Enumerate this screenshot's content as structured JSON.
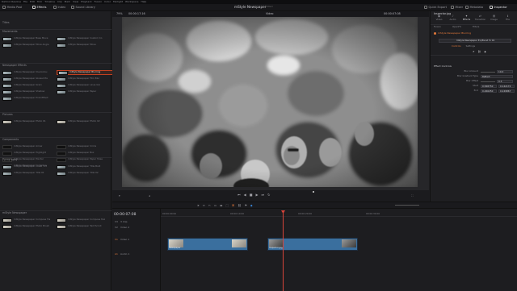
{
  "menu": [
    "DaVinci Resolve",
    "File",
    "Edit",
    "Trim",
    "Timeline",
    "Clip",
    "Mark",
    "View",
    "Playback",
    "Fusion",
    "Color",
    "Fairlight",
    "Workspace",
    "Help"
  ],
  "toolbar": {
    "left_items": [
      "Media Pool",
      "Effects",
      "Index",
      "Sound Library"
    ],
    "project_title": "mStyle Newspaper",
    "project_status": "Edited",
    "right_items": [
      "Quick Export",
      "Mixer",
      "Metadata",
      "Inspector"
    ]
  },
  "effects_panel": {
    "top_label": "Titles",
    "sections": [
      {
        "title": "Movements",
        "items": [
          "mStyle Newspaper Base Move",
          "mStyle Newspaper Custom Co",
          "mStyle Newspaper Move Angle",
          "mStyle Newspaper Move"
        ]
      },
      {
        "title": "Newspaper Effects",
        "items": [
          "mStyle Newspaper Overcolou",
          "mStyle Newspaper Blurring",
          "mStyle Newspaper Glowed Pa",
          "mStyle Newspaper Film Blur",
          "mStyle Newspaper Grain",
          "mStyle Newspaper Lines Glo",
          "mStyle Newspaper Shadow",
          "mStyle Newspaper Paper",
          "mStyle Newspaper Print Effect"
        ]
      },
      {
        "title": "Pictures",
        "items": [
          "mStyle Newspaper Photo 01",
          "mStyle Newspaper Photo 02"
        ]
      },
      {
        "title": "Components",
        "items": [
          "mStyle Newspaper Arrow",
          "mStyle Newspaper Circle",
          "mStyle Newspaper Highlight",
          "mStyle Newspaper Box",
          "mStyle Newspaper Pointer",
          "mStyle Newspaper Paper Shee",
          "mStyle Newspaper Underline"
        ]
      },
      {
        "title": "Typography",
        "items": [
          "mStyle Newspaper Lower 3rd",
          "mStyle Newspaper Title Bold",
          "mStyle Newspaper Title 01",
          "mStyle Newspaper Title 02"
        ]
      },
      {
        "title": "mStyle Newspaper",
        "items": [
          "mStyle Newspaper Compose Fla",
          "mStyle Newspaper Compose Mul",
          "mStyle Newspaper Photo Brush",
          "mStyle Newspaper Text Scroll"
        ]
      }
    ],
    "selected_item": "mStyle Newspaper Blurring"
  },
  "viewer": {
    "zoom": "79%",
    "timecode_left": "00:00:17:16",
    "clip_name": "Video",
    "timecode_right": "00:00:07:08"
  },
  "inspector": {
    "clip_title": "Inspector.jpg",
    "tabs": [
      "Video",
      "Audio",
      "Effects",
      "Transition",
      "Image",
      "File"
    ],
    "active_tab": "Effects",
    "subtabs": [
      "Fusion",
      "OpenFX",
      "Filters"
    ],
    "effect_name": "mStyle Newspaper Blurring",
    "preset_field": "mStyle Newspaper Eq Blend fx 01",
    "buttons": [
      "Controls",
      "Settings"
    ],
    "section_title": "Effect Controls",
    "params": [
      {
        "label": "Blur Amount",
        "value": "10.0"
      },
      {
        "label": "Blur Gradient Type",
        "value": "Reflect"
      },
      {
        "label": "Blur Offset",
        "value": "0.3"
      },
      {
        "label": "Start",
        "value1": "0.568750",
        "value2": "0.142174"
      },
      {
        "label": "End",
        "value1": "0.466250",
        "value2": "0.249867"
      }
    ]
  },
  "timeline": {
    "timecode": "00:00:07:08",
    "ruler": [
      "00:00:00:00",
      "00:00:10:00",
      "00:00:20:00",
      "00:00:30:00"
    ],
    "tracks": [
      {
        "id": "V3",
        "name": "3 Clip",
        "kind": "video"
      },
      {
        "id": "V2",
        "name": "Video 2",
        "kind": "video"
      },
      {
        "id": "V1",
        "name": "Video 1",
        "kind": "video"
      },
      {
        "id": "A1",
        "name": "Audio 1",
        "kind": "audio"
      }
    ],
    "clips": [
      {
        "name": "Newspaper",
        "track": "V1"
      },
      {
        "name": "Inspector.jpg",
        "track": "V1"
      }
    ]
  },
  "colors": {
    "accent": "#e0783a",
    "playhead": "#d8443a",
    "clip": "#3a6f9e",
    "selection": "#c04020"
  }
}
